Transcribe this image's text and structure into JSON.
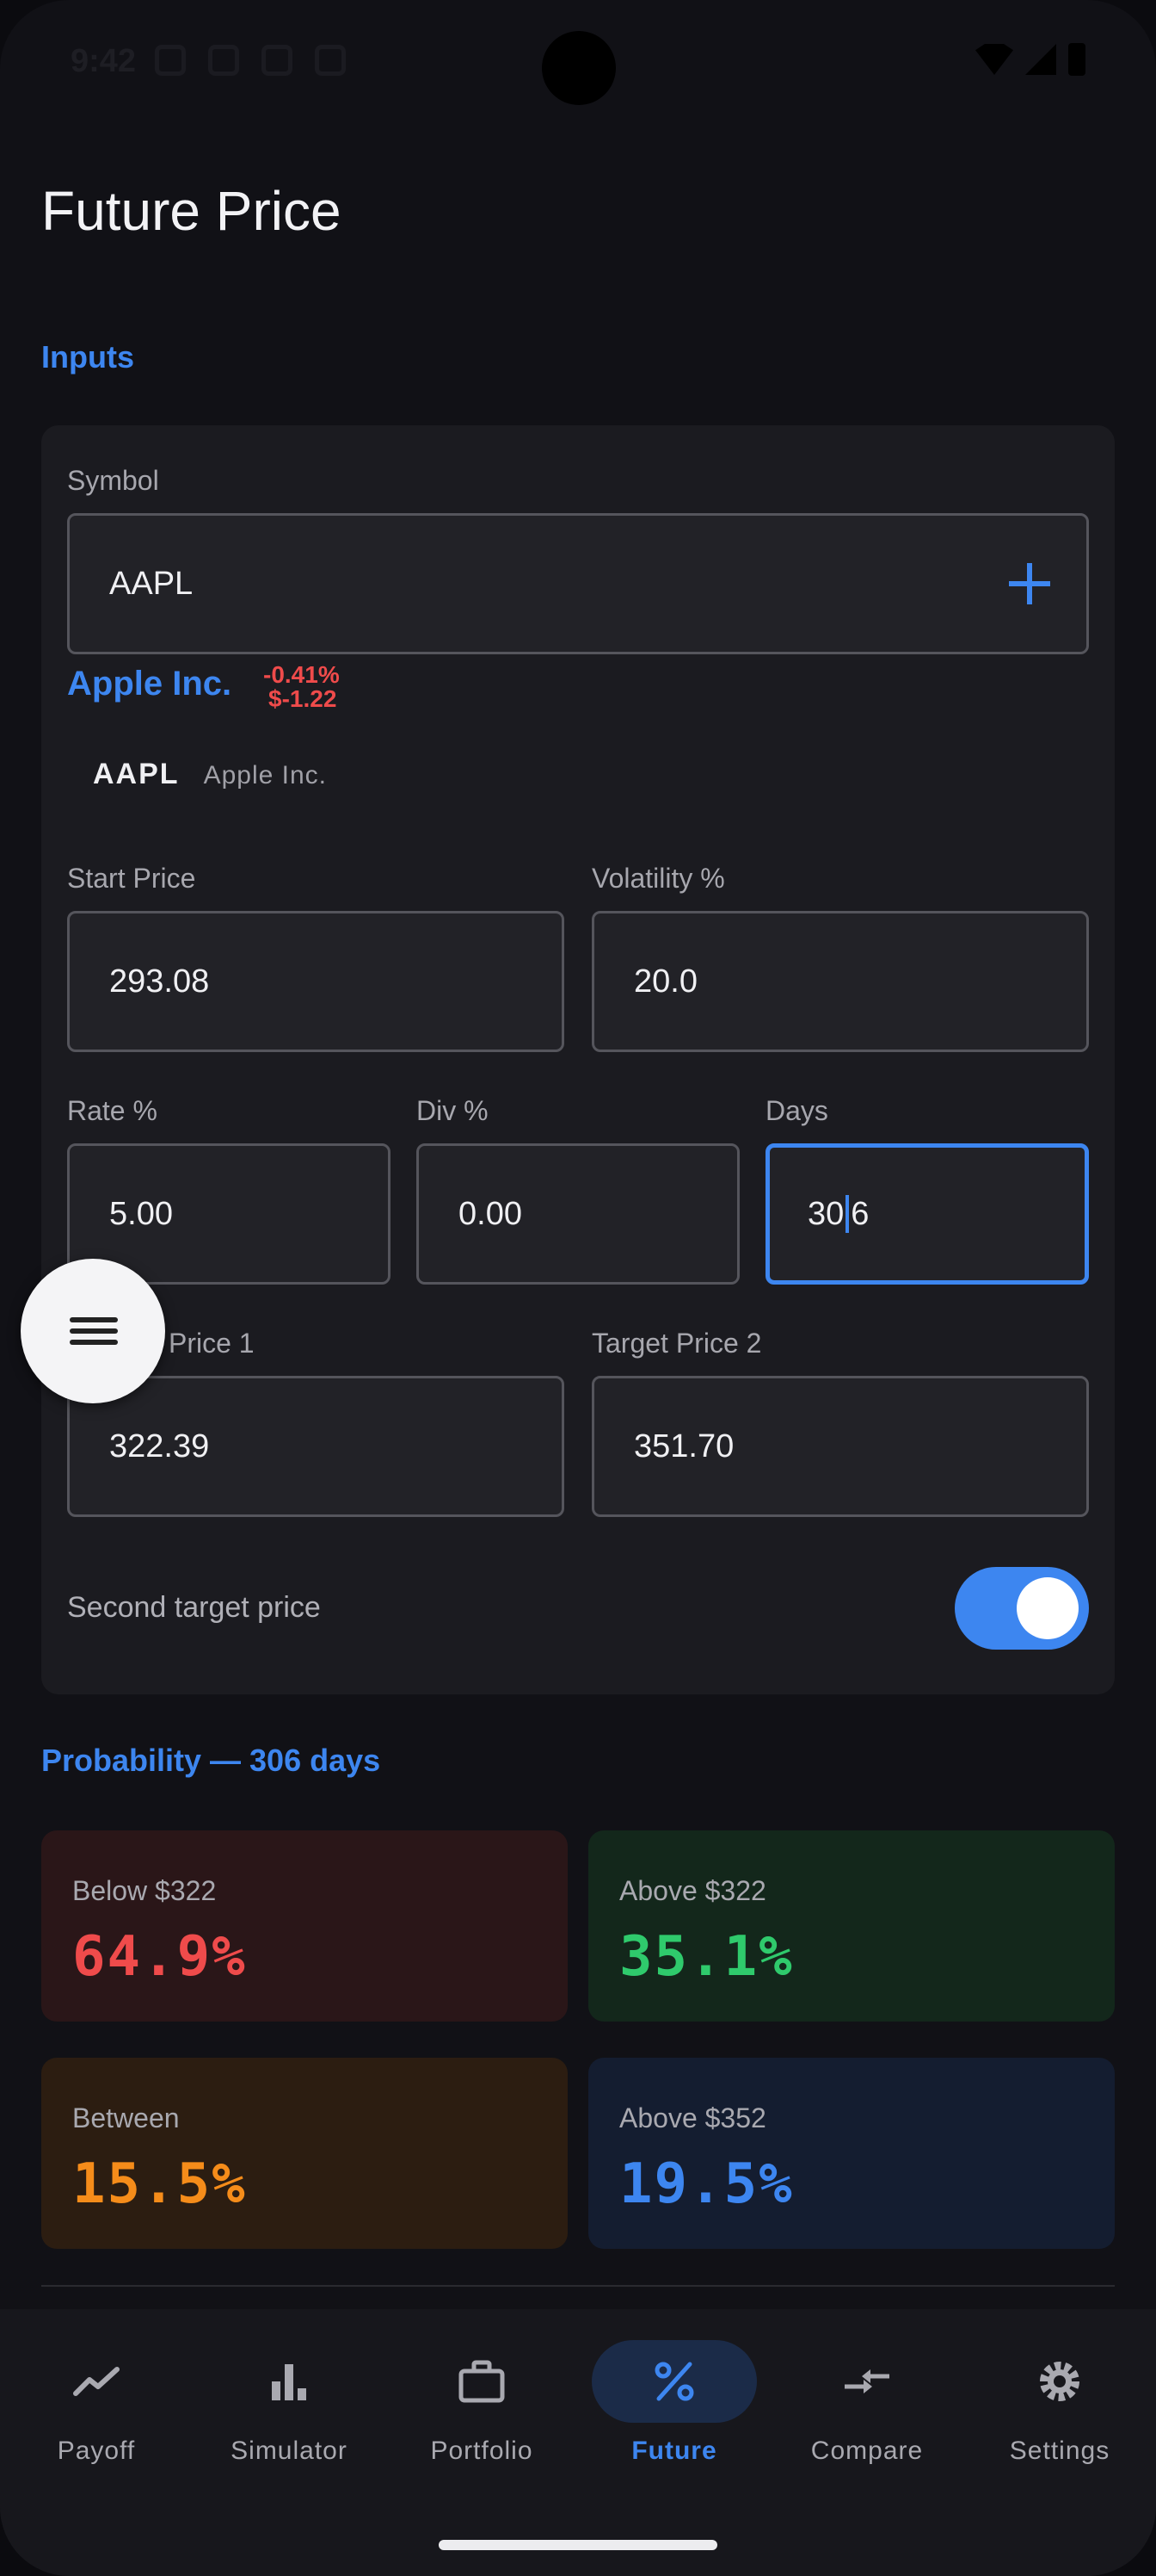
{
  "status_bar": {
    "time": "9:42"
  },
  "page": {
    "title": "Future Price",
    "inputs_heading": "Inputs"
  },
  "symbol": {
    "label": "Symbol",
    "value": "AAPL"
  },
  "quote": {
    "company": "Apple Inc.",
    "change_pct": "-0.41%",
    "change_abs": "$-1.22"
  },
  "suggestion": {
    "symbol": "AAPL",
    "name": "Apple Inc."
  },
  "fields": {
    "start_price": {
      "label": "Start Price",
      "value": "293.08"
    },
    "volatility": {
      "label": "Volatility %",
      "value": "20.0"
    },
    "rate": {
      "label": "Rate %",
      "value": "5.00"
    },
    "div": {
      "label": "Div %",
      "value": "0.00"
    },
    "days": {
      "label": "Days",
      "value_before_caret": "30",
      "value_after_caret": "6"
    },
    "target1": {
      "label": "Target Price 1",
      "label_visible": "Price 1",
      "value": "322.39"
    },
    "target2": {
      "label": "Target Price 2",
      "value": "351.70"
    }
  },
  "second_target": {
    "label": "Second target price",
    "enabled": true
  },
  "probability": {
    "heading": "Probability — 306 days",
    "cards": [
      {
        "label": "Below $322",
        "value": "64.9%",
        "color": "#ef4b4b",
        "bg": "#2a1618"
      },
      {
        "label": "Above $322",
        "value": "35.1%",
        "color": "#2fca6c",
        "bg": "#13271b"
      },
      {
        "label": "Between",
        "value": "15.5%",
        "color": "#f58c1a",
        "bg": "#2c1d11"
      },
      {
        "label": "Above $352",
        "value": "19.5%",
        "color": "#3d86f0",
        "bg": "#141d30"
      }
    ]
  },
  "nav": {
    "items": [
      {
        "label": "Payoff",
        "icon": "trending-icon"
      },
      {
        "label": "Simulator",
        "icon": "bar-chart-icon"
      },
      {
        "label": "Portfolio",
        "icon": "briefcase-icon"
      },
      {
        "label": "Future",
        "icon": "percent-icon",
        "active": true
      },
      {
        "label": "Compare",
        "icon": "compare-arrows-icon"
      },
      {
        "label": "Settings",
        "icon": "gear-icon"
      }
    ]
  },
  "colors": {
    "accent": "#3d86f0",
    "negative": "#ef4b4b"
  }
}
